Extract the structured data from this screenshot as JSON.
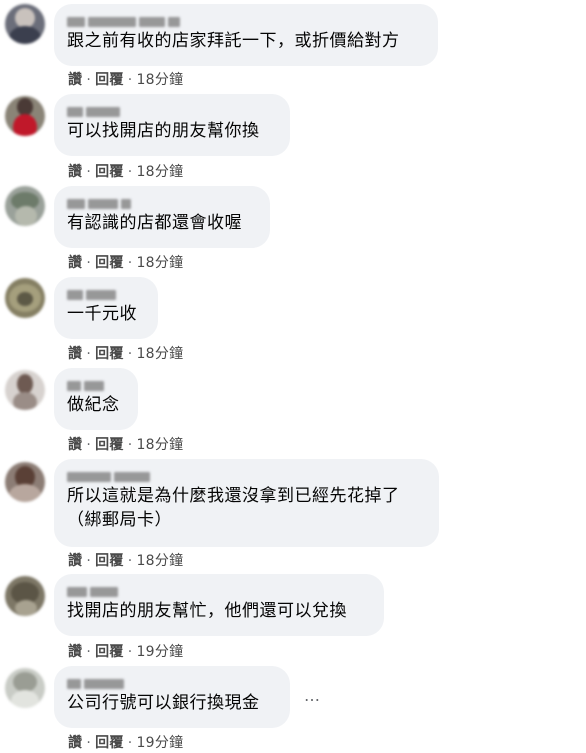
{
  "comments": [
    {
      "text": "跟之前有收的店家拜託一下，或折價給對方",
      "like": "讚",
      "reply": "回覆",
      "time": "18分鐘"
    },
    {
      "text": "可以找開店的朋友幫你換",
      "like": "讚",
      "reply": "回覆",
      "time": "18分鐘"
    },
    {
      "text": "有認識的店都還會收喔",
      "like": "讚",
      "reply": "回覆",
      "time": "18分鐘"
    },
    {
      "text": "一千元收",
      "like": "讚",
      "reply": "回覆",
      "time": "18分鐘"
    },
    {
      "text": "做紀念",
      "like": "讚",
      "reply": "回覆",
      "time": "18分鐘"
    },
    {
      "text": "所以這就是為什麼我還沒拿到已經先花掉了\n（綁郵局卡）",
      "like": "讚",
      "reply": "回覆",
      "time": "18分鐘"
    },
    {
      "text": "找開店的朋友幫忙，他們還可以兌換",
      "like": "讚",
      "reply": "回覆",
      "time": "19分鐘"
    },
    {
      "text": "公司行號可以銀行換現金",
      "like": "讚",
      "reply": "回覆",
      "time": "19分鐘"
    }
  ],
  "more_icon": "…",
  "colors": {
    "bubble": "#f0f2f5",
    "text": "#050505",
    "meta": "#65676b"
  }
}
